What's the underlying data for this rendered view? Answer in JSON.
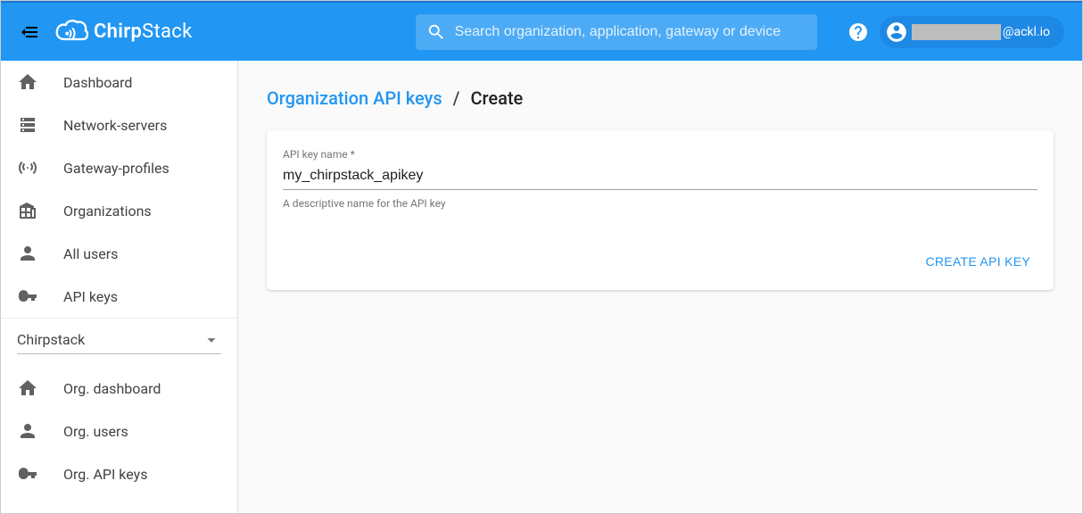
{
  "header": {
    "search_placeholder": "Search organization, application, gateway or device",
    "user_domain_suffix": "@ackl.io"
  },
  "sidebar": {
    "items": [
      {
        "label": "Dashboard",
        "name": "dashboard"
      },
      {
        "label": "Network-servers",
        "name": "network-servers"
      },
      {
        "label": "Gateway-profiles",
        "name": "gateway-profiles"
      },
      {
        "label": "Organizations",
        "name": "organizations"
      },
      {
        "label": "All users",
        "name": "all-users"
      },
      {
        "label": "API keys",
        "name": "api-keys"
      }
    ],
    "org_selected": "Chirpstack",
    "org_items": [
      {
        "label": "Org. dashboard",
        "name": "org-dashboard"
      },
      {
        "label": "Org. users",
        "name": "org-users"
      },
      {
        "label": "Org. API keys",
        "name": "org-api-keys"
      }
    ]
  },
  "breadcrumb": {
    "link_label": "Organization API keys",
    "current_label": "Create"
  },
  "form": {
    "field_label": "API key name *",
    "field_value": "my_chirpstack_apikey",
    "helper_text": "A descriptive name for the API key",
    "submit_label": "CREATE API KEY"
  }
}
